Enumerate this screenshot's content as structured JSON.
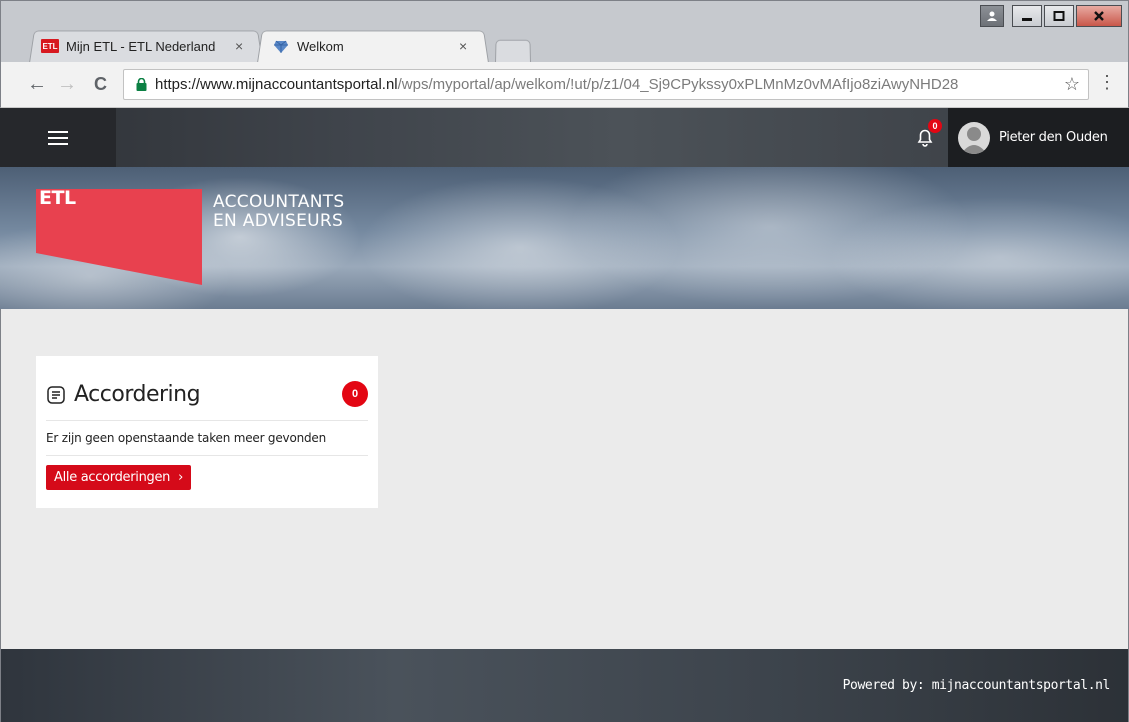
{
  "browser": {
    "tabs": [
      {
        "title": "Mijn ETL - ETL Nederland",
        "favicon": "etl-favicon",
        "close": "×"
      },
      {
        "title": "Welkom",
        "favicon": "gem-favicon",
        "close": "×",
        "active": true
      }
    ],
    "url_host": "https://www.mijnaccountantsportal.nl",
    "url_path": "/wps/myportal/ap/welkom/!ut/p/z1/04_Sj9CPykssy0xPLMnMz0vMAfIjo8ziAwyNHD28",
    "nav": {
      "back": "←",
      "forward": "→",
      "reload": "C"
    },
    "window_buttons": {
      "minimize": "‒",
      "maximize": "□",
      "close": "x"
    }
  },
  "header": {
    "notification_count": "0",
    "username": "Pieter den Ouden"
  },
  "hero": {
    "logo": "ETL",
    "tagline_1": "ACCOUNTANTS",
    "tagline_2": "EN ADVISEURS"
  },
  "card": {
    "title": "Accordering",
    "count": "0",
    "message": "Er zijn geen openstaande taken meer gevonden",
    "button_label": "Alle accorderingen",
    "button_chevron": "›"
  },
  "footer": {
    "text": "Powered by: mijnaccountantsportal.nl"
  },
  "colors": {
    "accent": "#e30613",
    "button": "#d50a19",
    "logo_red": "#e8414f"
  }
}
